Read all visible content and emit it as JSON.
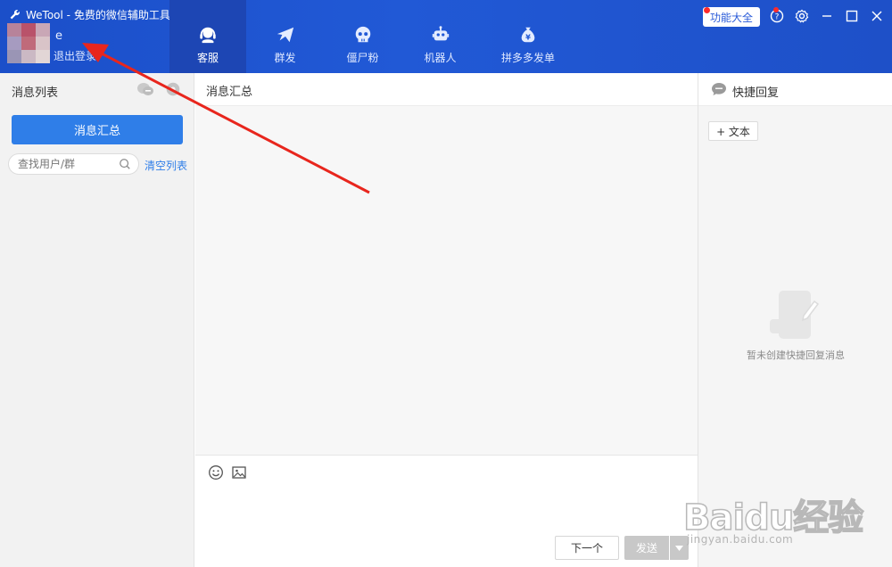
{
  "app": {
    "title": "WeTool - 免费的微信辅助工具"
  },
  "account": {
    "username": "e",
    "logout_label": "退出登录"
  },
  "nav": {
    "items": [
      {
        "label": "客服",
        "icon": "headset-icon",
        "active": true
      },
      {
        "label": "群发",
        "icon": "paper-plane-icon",
        "active": false
      },
      {
        "label": "僵尸粉",
        "icon": "skull-icon",
        "active": false
      },
      {
        "label": "机器人",
        "icon": "robot-icon",
        "active": false
      },
      {
        "label": "拼多多发单",
        "icon": "money-bag-icon",
        "active": false
      }
    ]
  },
  "toolbar": {
    "features_label": "功能大全"
  },
  "left_panel": {
    "title": "消息列表",
    "summary_button": "消息汇总",
    "search_placeholder": "查找用户/群",
    "clear_label": "清空列表"
  },
  "center_panel": {
    "title": "消息汇总",
    "next_label": "下一个",
    "send_label": "发送"
  },
  "right_panel": {
    "title": "快捷回复",
    "add_text_label": "+ 文本",
    "empty_message": "暂未创建快捷回复消息"
  },
  "watermark": {
    "brand": "Baidu经验",
    "url": "jingyan.baidu.com"
  },
  "colors": {
    "header_blue": "#1f52cf",
    "accent_blue": "#2f7ee8",
    "annotation_red": "#e8261d"
  }
}
